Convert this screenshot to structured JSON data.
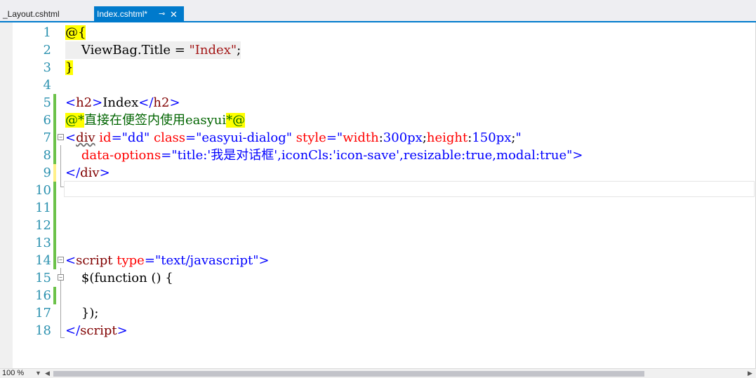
{
  "tabs": [
    {
      "label": "_Layout.cshtml",
      "active": false
    },
    {
      "label": "Index.cshtml*",
      "active": true
    }
  ],
  "tab_icons": {
    "pin": "pin-icon",
    "close": "close-icon"
  },
  "line_numbers": [
    "1",
    "2",
    "3",
    "4",
    "5",
    "6",
    "7",
    "8",
    "9",
    "10",
    "11",
    "12",
    "13",
    "14",
    "15",
    "16",
    "17",
    "18"
  ],
  "code": {
    "l1_open": "@{",
    "l2_a": "    ViewBag.Title = ",
    "l2_str": "\"Index\"",
    "l2_semi": ";",
    "l3_close": "}",
    "l5_lt": "<",
    "l5_tag": "h2",
    "l5_gt": ">",
    "l5_text": "Index",
    "l5_lt2": "</",
    "l5_tag2": "h2",
    "l5_gt2": ">",
    "l6_open": "@*",
    "l6_comment": "直接在便签内使用easyui",
    "l6_close": "*@",
    "l7_lt": "<",
    "l7_tag": "div",
    "l7_a1": " id",
    "l7_eq1": "=",
    "l7_v1": "\"dd\"",
    "l7_a2": " class",
    "l7_eq2": "=",
    "l7_v2": "\"easyui-dialog\"",
    "l7_a3": " style",
    "l7_eq3": "=",
    "l7_q3": "\"",
    "l7_v3a": "width",
    "l7_c1": ":",
    "l7_v3b": "300px",
    "l7_s1": ";",
    "l7_v3c": "height",
    "l7_c2": ":",
    "l7_v3d": "150px",
    "l7_s2": ";",
    "l7_q4": "\"",
    "l8_indent": "    ",
    "l8_attr": "data-options",
    "l8_eq": "=",
    "l8_val": "\"title:'我是对话框',iconCls:'icon-save',resizable:true,modal:true\"",
    "l8_gt": ">",
    "l9_lt": "</",
    "l9_tag": "div",
    "l9_gt": ">",
    "l14_lt": "<",
    "l14_tag": "script",
    "l14_attr": " type",
    "l14_eq": "=",
    "l14_val": "\"text/javascript\"",
    "l14_gt": ">",
    "l15": "    $(function () {",
    "l17": "    });",
    "l18_lt": "</",
    "l18_tag": "script",
    "l18_gt": ">"
  },
  "status": {
    "zoom": "100 %"
  }
}
